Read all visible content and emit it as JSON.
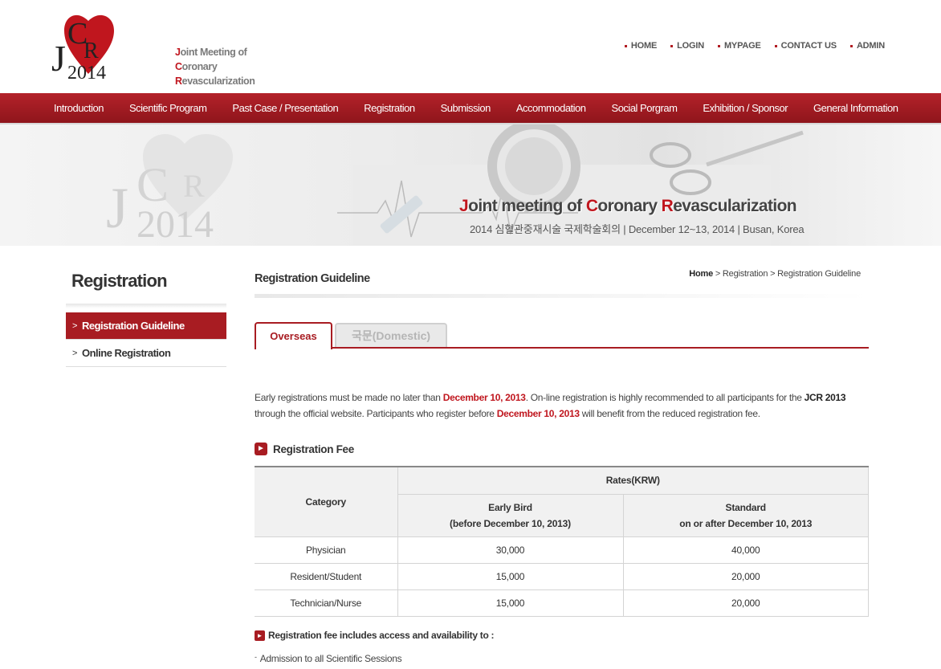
{
  "logo": {
    "mark_letters": [
      "J",
      "C",
      "R"
    ],
    "mark_year": "2014",
    "tagline": [
      {
        "cap": "J",
        "rest": "oint Meeting of"
      },
      {
        "cap": "C",
        "rest": "oronary"
      },
      {
        "cap": "R",
        "rest": "evascularization"
      }
    ]
  },
  "top_links": [
    "HOME",
    "LOGIN",
    "MYPAGE",
    "CONTACT US",
    "ADMIN"
  ],
  "nav": [
    "Introduction",
    "Scientific Program",
    "Past Case / Presentation",
    "Registration",
    "Submission",
    "Accommodation",
    "Social Porgram",
    "Exhibition / Sponsor",
    "General Information"
  ],
  "banner": {
    "watermark_letters": [
      "J",
      "C",
      "R"
    ],
    "watermark_year": "2014",
    "title_parts": [
      {
        "cap": "J",
        "rest": "oint meeting of "
      },
      {
        "cap": "C",
        "rest": "oronary "
      },
      {
        "cap": "R",
        "rest": "evascularization"
      }
    ],
    "subtitle": "2014 심혈관중재시술 국제학술회의 | December 12~13, 2014   | Busan, Korea"
  },
  "sidebar": {
    "title": "Registration",
    "items": [
      {
        "label": "Registration Guideline",
        "active": true
      },
      {
        "label": "Online Registration",
        "active": false
      }
    ]
  },
  "content": {
    "title": "Registration Guideline",
    "breadcrumb": {
      "home": "Home",
      "rest": " > Registration > Registration Guideline"
    },
    "tabs": [
      "Overseas",
      "국문(Domestic)"
    ],
    "intro": {
      "p1": "Early registrations must be made no later than ",
      "d1": "December 10, 2013",
      "p2": ". On-line registration is highly recommended to all participants for the ",
      "jcr": "JCR 2013",
      "p3": " through the official website. Participants who register before ",
      "d2": "December 10, 2013",
      "p4": " will benefit from the reduced registration fee."
    },
    "fee_section_title": "Registration Fee",
    "fee_table": {
      "category_header": "Category",
      "rates_header": "Rates(KRW)",
      "early_bird": {
        "line1": "Early Bird",
        "line2": "(before December 10, 2013)"
      },
      "standard": {
        "line1": "Standard",
        "line2": "on or after December 10, 2013"
      },
      "rows": [
        {
          "category": "Physician",
          "early": "30,000",
          "standard": "40,000"
        },
        {
          "category": "Resident/Student",
          "early": "15,000",
          "standard": "20,000"
        },
        {
          "category": "Technician/Nurse",
          "early": "15,000",
          "standard": "20,000"
        }
      ]
    },
    "includes_title": "Registration fee includes access and availability to :",
    "includes_items": [
      "Admission to all Scientific Sessions"
    ]
  },
  "colors": {
    "brand_red": "#a81c22",
    "highlight_red": "#c0161e"
  }
}
